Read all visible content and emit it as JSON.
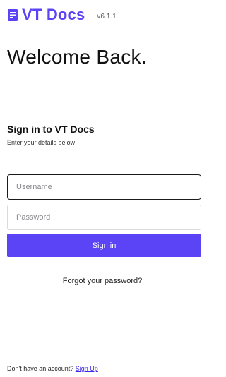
{
  "brand": {
    "name": "VT Docs",
    "version": "v6.1.1",
    "icon": "document-icon",
    "color": "#5b43f6"
  },
  "welcome": {
    "heading": "Welcome Back."
  },
  "signin": {
    "title": "Sign in to VT Docs",
    "subtitle": "Enter your details below",
    "username_placeholder": "Username",
    "password_placeholder": "Password",
    "button_label": "Sign in",
    "forgot_label": "Forgot your password?"
  },
  "signup": {
    "prompt": "Don't have an account?",
    "link_label": "Sign Up"
  },
  "colors": {
    "accent": "#5b43f6",
    "link": "#3b28e8"
  }
}
